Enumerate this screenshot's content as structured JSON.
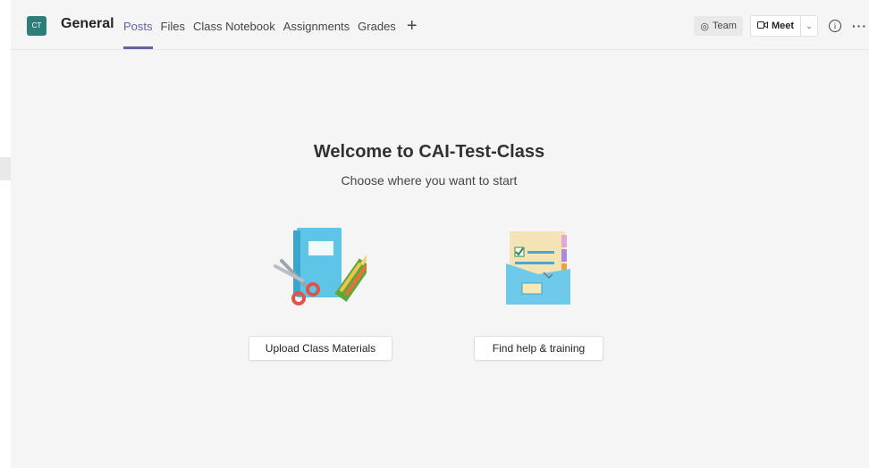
{
  "channel": {
    "avatar_text": "CT",
    "title": "General"
  },
  "tabs": [
    {
      "label": "Posts",
      "active": true
    },
    {
      "label": "Files",
      "active": false
    },
    {
      "label": "Class Notebook",
      "active": false
    },
    {
      "label": "Assignments",
      "active": false
    },
    {
      "label": "Grades",
      "active": false
    }
  ],
  "add_tab_icon": "plus-icon",
  "header_actions": {
    "team_label": "Team",
    "team_icon": "eye-icon",
    "meet_label": "Meet",
    "meet_icon": "video-camera-icon",
    "info_icon": "info-icon",
    "more_icon": "more-icon"
  },
  "welcome": {
    "title": "Welcome to CAI-Test-Class",
    "subtitle": "Choose where you want to start"
  },
  "actions": {
    "upload_label": "Upload Class Materials",
    "help_label": "Find help & training"
  },
  "colors": {
    "accent": "#6264a7",
    "avatar_bg": "#2d7d7b"
  }
}
